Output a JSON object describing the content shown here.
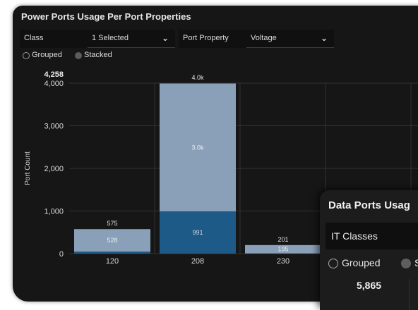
{
  "power_panel": {
    "title": "Power Ports Usage Per Port Properties",
    "class_label": "Class",
    "class_value": "1 Selected",
    "property_label": "Port Property",
    "property_value": "Voltage",
    "mode_grouped": "Grouped",
    "mode_stacked": "Stacked",
    "selected_mode": "Stacked"
  },
  "chart_data": {
    "type": "bar",
    "stacked": true,
    "categories": [
      "120",
      "208",
      "230"
    ],
    "series": [
      {
        "values": [
          47,
          991,
          6
        ],
        "color": "#1d5a87"
      },
      {
        "values": [
          528,
          3000,
          195
        ],
        "color": "#8aa0b8"
      }
    ],
    "totals": [
      575,
      4000,
      201
    ],
    "segment_labels": [
      [
        "",
        "991",
        ""
      ],
      [
        "528",
        "3.0k",
        "195"
      ]
    ],
    "total_labels": [
      "575",
      "4.0k",
      "201"
    ],
    "max_label": "4,258",
    "ylabel": "Port Count",
    "yticks": [
      0,
      1000,
      2000,
      3000,
      4000
    ],
    "ytick_labels": [
      "0",
      "1,000",
      "2,000",
      "3,000",
      "4,000"
    ],
    "ylim": [
      0,
      4000
    ],
    "grid": true
  },
  "data_panel": {
    "title": "Data Ports Usag",
    "class_value": "IT Classes",
    "mode_grouped": "Grouped",
    "mode_stacked": "S",
    "max_label": "5,865"
  },
  "colors": {
    "background": "#161616",
    "grid": "#3a3a3a",
    "bar_dark": "#1d5a87",
    "bar_light": "#8aa0b8"
  }
}
